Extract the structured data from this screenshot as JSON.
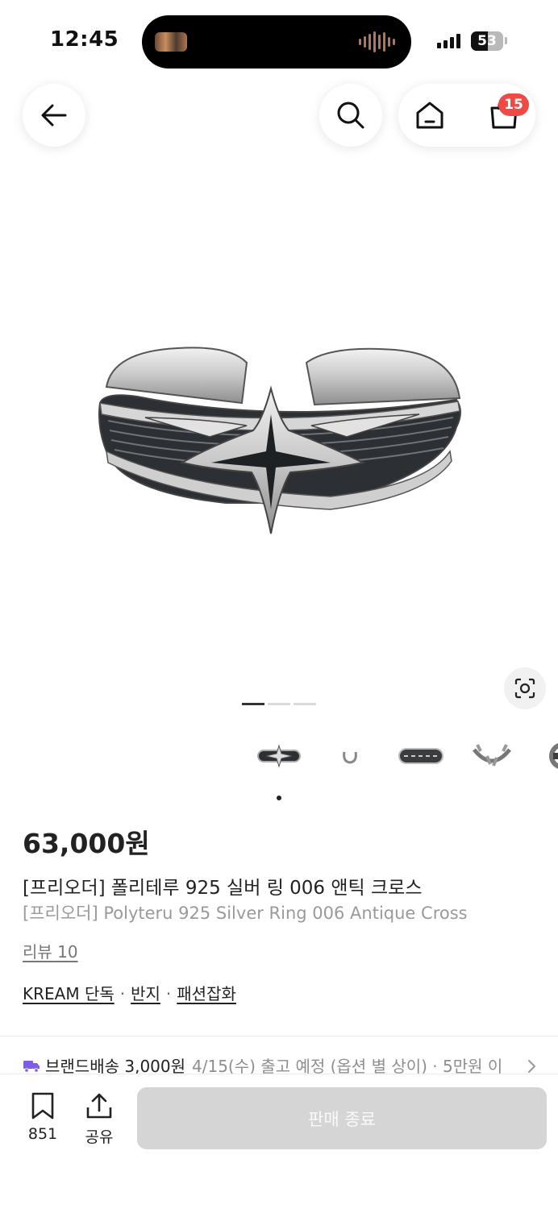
{
  "status_bar": {
    "time": "12:45",
    "battery": "53",
    "battery_level": 0.53
  },
  "nav": {
    "cart_count": "15"
  },
  "gallery": {
    "page_count": 3,
    "active_index": 0
  },
  "product": {
    "price": "63,000원",
    "title_ko": "[프리오더] 폴리테루 925 실버 링 006 앤틱 크로스",
    "title_en": "[프리오더] Polyteru 925 Silver Ring 006 Antique Cross",
    "review": "리뷰 10",
    "tags": [
      "KREAM 단독",
      "반지",
      "패션잡화"
    ]
  },
  "shipping": {
    "main": "브랜드배송 3,000원",
    "sub": "4/15(수) 출고 예정 (옵션 별 상이) · 5만원 이"
  },
  "bottom": {
    "save_count": "851",
    "share_label": "공유",
    "cta_label": "판매 종료"
  },
  "colors": {
    "badge": "#ef4a43",
    "shipping_icon": "#7d5cf0",
    "cta_disabled": "#d5d5d5"
  }
}
